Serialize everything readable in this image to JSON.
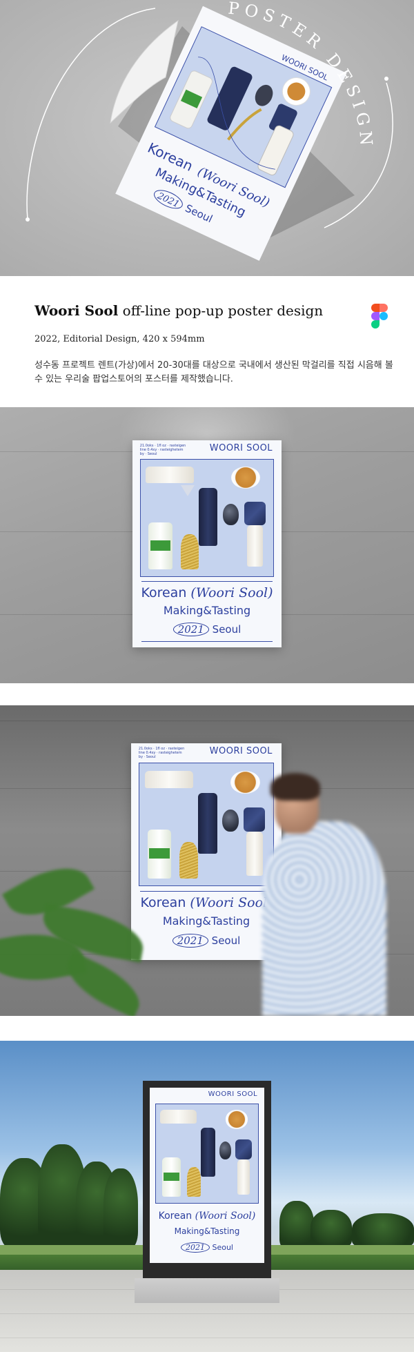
{
  "hero": {
    "arc_text": "POSTER DESIGN",
    "poster_brand": "WOORI SOOL",
    "poster_title_line1_a": "Korean",
    "poster_title_line1_b": "(Woori Sool)",
    "poster_title_line2": "Making&Tasting",
    "poster_title_line3_year": "2021",
    "poster_title_line3_city": "Seoul"
  },
  "info": {
    "title_bold": "Woori Sool",
    "title_rest": " off-line pop-up poster design",
    "meta": "2022, Editorial Design, 420 x 594mm",
    "description": "성수동 프로젝트 렌트(가상)에서 20-30대를 대상으로 국내에서 생산된 막걸리를 직접 시음해 볼 수 있는 우리술 팝업스토어의 포스터를 제작했습니다.",
    "tool_icon": "figma-icon"
  },
  "poster": {
    "brand": "WOORI SOOL",
    "small_note": "21.0oks · 1fl oz · rasteigen line 0.4xy · rasteighetem by · Seoul",
    "title_line1_a": "Korean",
    "title_line1_b": "(Woori Sool)",
    "title_line2": "Making&Tasting",
    "title_line3_year": "2021",
    "title_line3_city": "Seoul",
    "accent": "#2c3f9e",
    "board_color": "#c5d3ee"
  },
  "colors": {
    "page_bg": "#ffffff",
    "hero_bg": "#b7b7b7",
    "poster_blue": "#2c3f9e"
  }
}
